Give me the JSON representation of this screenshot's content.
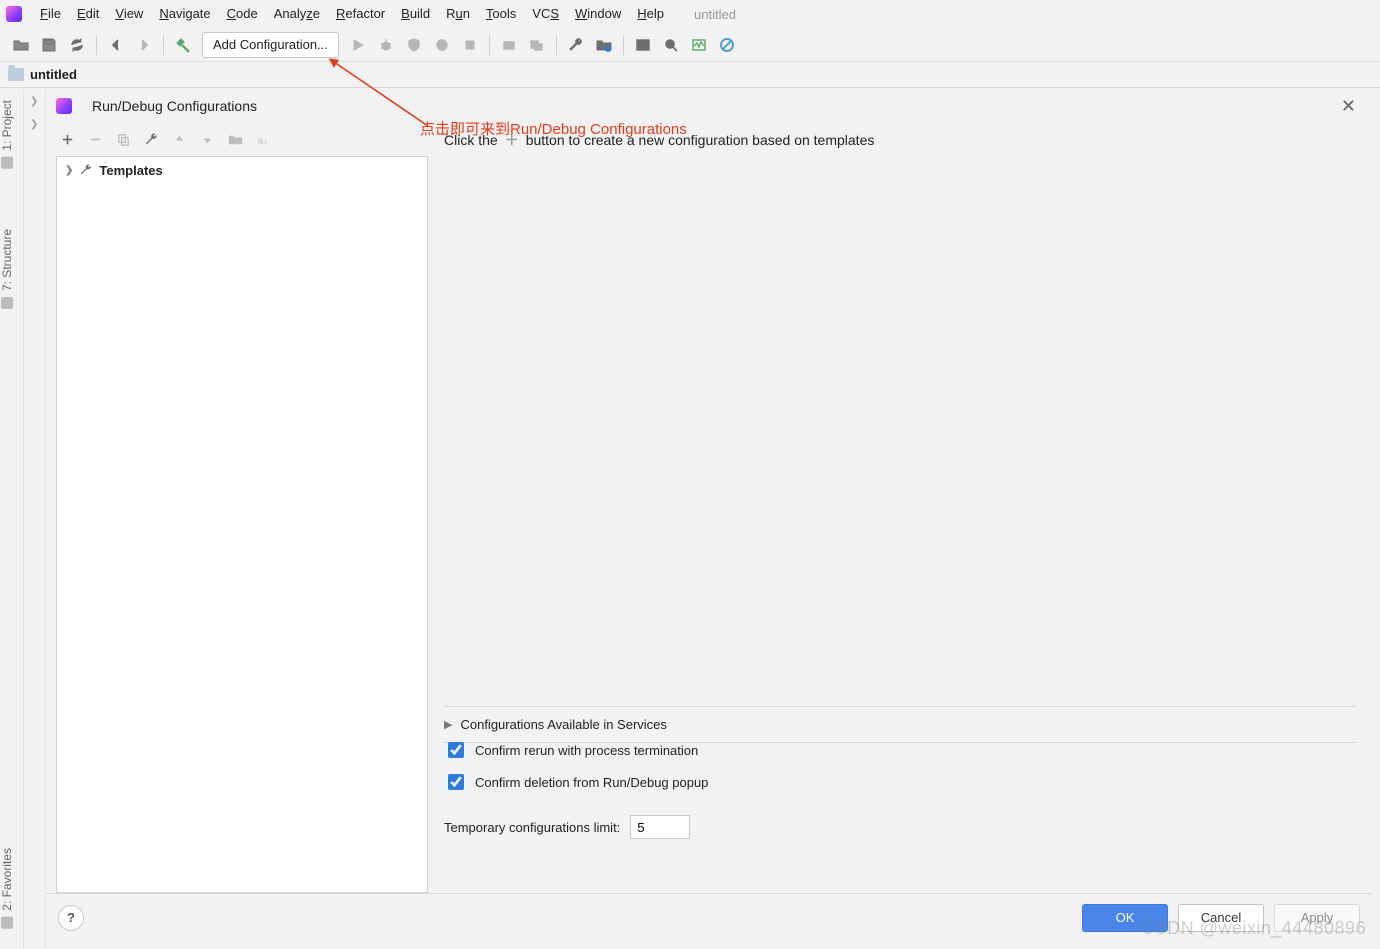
{
  "menu": {
    "items": [
      "File",
      "Edit",
      "View",
      "Navigate",
      "Code",
      "Analyze",
      "Refactor",
      "Build",
      "Run",
      "Tools",
      "VCS",
      "Window",
      "Help"
    ],
    "project_name": "untitled"
  },
  "toolbar": {
    "combo_label": "Add Configuration..."
  },
  "nav": {
    "project": "untitled"
  },
  "left_tabs": {
    "project": "1: Project",
    "structure": "7: Structure",
    "favorites": "2: Favorites"
  },
  "dialog": {
    "title": "Run/Debug Configurations",
    "tree_root": "Templates",
    "hint_pre": "Click the",
    "hint_post": "button to create a new configuration based on templates",
    "services_label": "Configurations Available in Services",
    "chk_rerun": "Confirm rerun with process termination",
    "chk_delete": "Confirm deletion from Run/Debug popup",
    "limit_label": "Temporary configurations limit:",
    "limit_value": "5",
    "ok": "OK",
    "cancel": "Cancel",
    "apply": "Apply"
  },
  "annotation": "点击即可来到Run/Debug Configurations",
  "watermark": "CSDN @weixin_44480896"
}
